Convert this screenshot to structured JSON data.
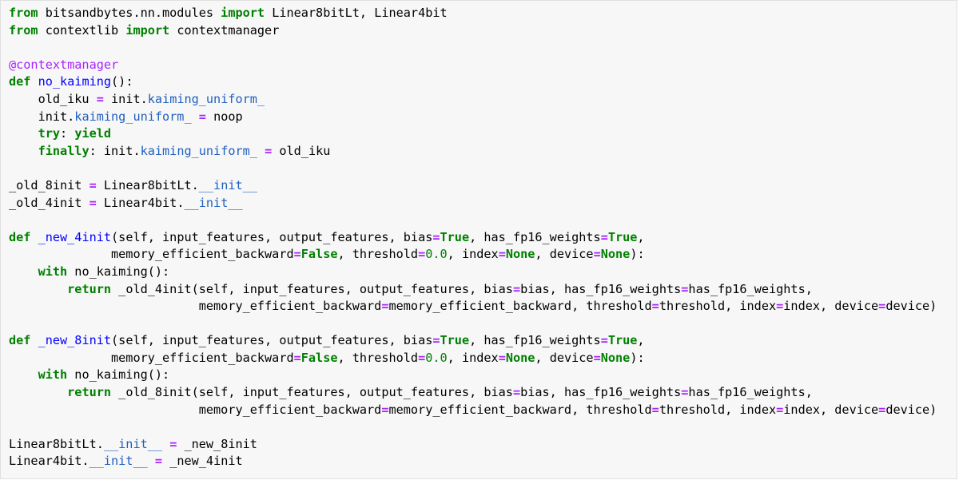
{
  "code": {
    "lines": [
      [
        {
          "t": "from",
          "c": "kw"
        },
        {
          "t": " bitsandbytes.nn.modules "
        },
        {
          "t": "import",
          "c": "kw"
        },
        {
          "t": " Linear8bitLt, Linear4bit"
        }
      ],
      [
        {
          "t": "from",
          "c": "kw"
        },
        {
          "t": " contextlib "
        },
        {
          "t": "import",
          "c": "kw"
        },
        {
          "t": " contextmanager"
        }
      ],
      [],
      [
        {
          "t": "@contextmanager",
          "c": "dec"
        }
      ],
      [
        {
          "t": "def",
          "c": "kw"
        },
        {
          "t": " "
        },
        {
          "t": "no_kaiming",
          "c": "fn"
        },
        {
          "t": "():"
        }
      ],
      [
        {
          "t": "    old_iku "
        },
        {
          "t": "=",
          "c": "op"
        },
        {
          "t": " init."
        },
        {
          "t": "kaiming_uniform_",
          "c": "attr"
        }
      ],
      [
        {
          "t": "    init."
        },
        {
          "t": "kaiming_uniform_",
          "c": "attr"
        },
        {
          "t": " "
        },
        {
          "t": "=",
          "c": "op"
        },
        {
          "t": " noop"
        }
      ],
      [
        {
          "t": "    "
        },
        {
          "t": "try",
          "c": "kw"
        },
        {
          "t": ": "
        },
        {
          "t": "yield",
          "c": "kw"
        }
      ],
      [
        {
          "t": "    "
        },
        {
          "t": "finally",
          "c": "kw"
        },
        {
          "t": ": init."
        },
        {
          "t": "kaiming_uniform_",
          "c": "attr"
        },
        {
          "t": " "
        },
        {
          "t": "=",
          "c": "op"
        },
        {
          "t": " old_iku"
        }
      ],
      [],
      [
        {
          "t": "_old_8init "
        },
        {
          "t": "=",
          "c": "op"
        },
        {
          "t": " Linear8bitLt."
        },
        {
          "t": "__init__",
          "c": "attr"
        }
      ],
      [
        {
          "t": "_old_4init "
        },
        {
          "t": "=",
          "c": "op"
        },
        {
          "t": " Linear4bit."
        },
        {
          "t": "__init__",
          "c": "attr"
        }
      ],
      [],
      [
        {
          "t": "def",
          "c": "kw"
        },
        {
          "t": " "
        },
        {
          "t": "_new_4init",
          "c": "fn"
        },
        {
          "t": "(self, input_features, output_features, bias"
        },
        {
          "t": "=",
          "c": "op"
        },
        {
          "t": "True",
          "c": "kw"
        },
        {
          "t": ", has_fp16_weights"
        },
        {
          "t": "=",
          "c": "op"
        },
        {
          "t": "True",
          "c": "kw"
        },
        {
          "t": ","
        }
      ],
      [
        {
          "t": "              memory_efficient_backward"
        },
        {
          "t": "=",
          "c": "op"
        },
        {
          "t": "False",
          "c": "kw"
        },
        {
          "t": ", threshold"
        },
        {
          "t": "=",
          "c": "op"
        },
        {
          "t": "0.0",
          "c": "num"
        },
        {
          "t": ", index"
        },
        {
          "t": "=",
          "c": "op"
        },
        {
          "t": "None",
          "c": "kw"
        },
        {
          "t": ", device"
        },
        {
          "t": "=",
          "c": "op"
        },
        {
          "t": "None",
          "c": "kw"
        },
        {
          "t": "):"
        }
      ],
      [
        {
          "t": "    "
        },
        {
          "t": "with",
          "c": "kw"
        },
        {
          "t": " no_kaiming():"
        }
      ],
      [
        {
          "t": "        "
        },
        {
          "t": "return",
          "c": "kw"
        },
        {
          "t": " _old_4init(self, input_features, output_features, bias"
        },
        {
          "t": "=",
          "c": "op"
        },
        {
          "t": "bias, has_fp16_weights"
        },
        {
          "t": "=",
          "c": "op"
        },
        {
          "t": "has_fp16_weights,"
        }
      ],
      [
        {
          "t": "                          memory_efficient_backward"
        },
        {
          "t": "=",
          "c": "op"
        },
        {
          "t": "memory_efficient_backward, threshold"
        },
        {
          "t": "=",
          "c": "op"
        },
        {
          "t": "threshold, index"
        },
        {
          "t": "=",
          "c": "op"
        },
        {
          "t": "index, device"
        },
        {
          "t": "=",
          "c": "op"
        },
        {
          "t": "device)"
        }
      ],
      [],
      [
        {
          "t": "def",
          "c": "kw"
        },
        {
          "t": " "
        },
        {
          "t": "_new_8init",
          "c": "fn"
        },
        {
          "t": "(self, input_features, output_features, bias"
        },
        {
          "t": "=",
          "c": "op"
        },
        {
          "t": "True",
          "c": "kw"
        },
        {
          "t": ", has_fp16_weights"
        },
        {
          "t": "=",
          "c": "op"
        },
        {
          "t": "True",
          "c": "kw"
        },
        {
          "t": ","
        }
      ],
      [
        {
          "t": "              memory_efficient_backward"
        },
        {
          "t": "=",
          "c": "op"
        },
        {
          "t": "False",
          "c": "kw"
        },
        {
          "t": ", threshold"
        },
        {
          "t": "=",
          "c": "op"
        },
        {
          "t": "0.0",
          "c": "num"
        },
        {
          "t": ", index"
        },
        {
          "t": "=",
          "c": "op"
        },
        {
          "t": "None",
          "c": "kw"
        },
        {
          "t": ", device"
        },
        {
          "t": "=",
          "c": "op"
        },
        {
          "t": "None",
          "c": "kw"
        },
        {
          "t": "):"
        }
      ],
      [
        {
          "t": "    "
        },
        {
          "t": "with",
          "c": "kw"
        },
        {
          "t": " no_kaiming():"
        }
      ],
      [
        {
          "t": "        "
        },
        {
          "t": "return",
          "c": "kw"
        },
        {
          "t": " _old_8init(self, input_features, output_features, bias"
        },
        {
          "t": "=",
          "c": "op"
        },
        {
          "t": "bias, has_fp16_weights"
        },
        {
          "t": "=",
          "c": "op"
        },
        {
          "t": "has_fp16_weights,"
        }
      ],
      [
        {
          "t": "                          memory_efficient_backward"
        },
        {
          "t": "=",
          "c": "op"
        },
        {
          "t": "memory_efficient_backward, threshold"
        },
        {
          "t": "=",
          "c": "op"
        },
        {
          "t": "threshold, index"
        },
        {
          "t": "=",
          "c": "op"
        },
        {
          "t": "index, device"
        },
        {
          "t": "=",
          "c": "op"
        },
        {
          "t": "device)"
        }
      ],
      [],
      [
        {
          "t": "Linear8bitLt."
        },
        {
          "t": "__init__",
          "c": "attr"
        },
        {
          "t": " "
        },
        {
          "t": "=",
          "c": "op"
        },
        {
          "t": " _new_8init"
        }
      ],
      [
        {
          "t": "Linear4bit."
        },
        {
          "t": "__init__",
          "c": "attr"
        },
        {
          "t": " "
        },
        {
          "t": "=",
          "c": "op"
        },
        {
          "t": " _new_4init"
        }
      ]
    ]
  },
  "colors": {
    "keyword": "#008000",
    "function_name": "#0000ff",
    "decorator": "#aa22ff",
    "operator": "#aa22ff",
    "attribute": "#1f5fbf",
    "number": "#008000",
    "background": "#f7f7f7"
  }
}
